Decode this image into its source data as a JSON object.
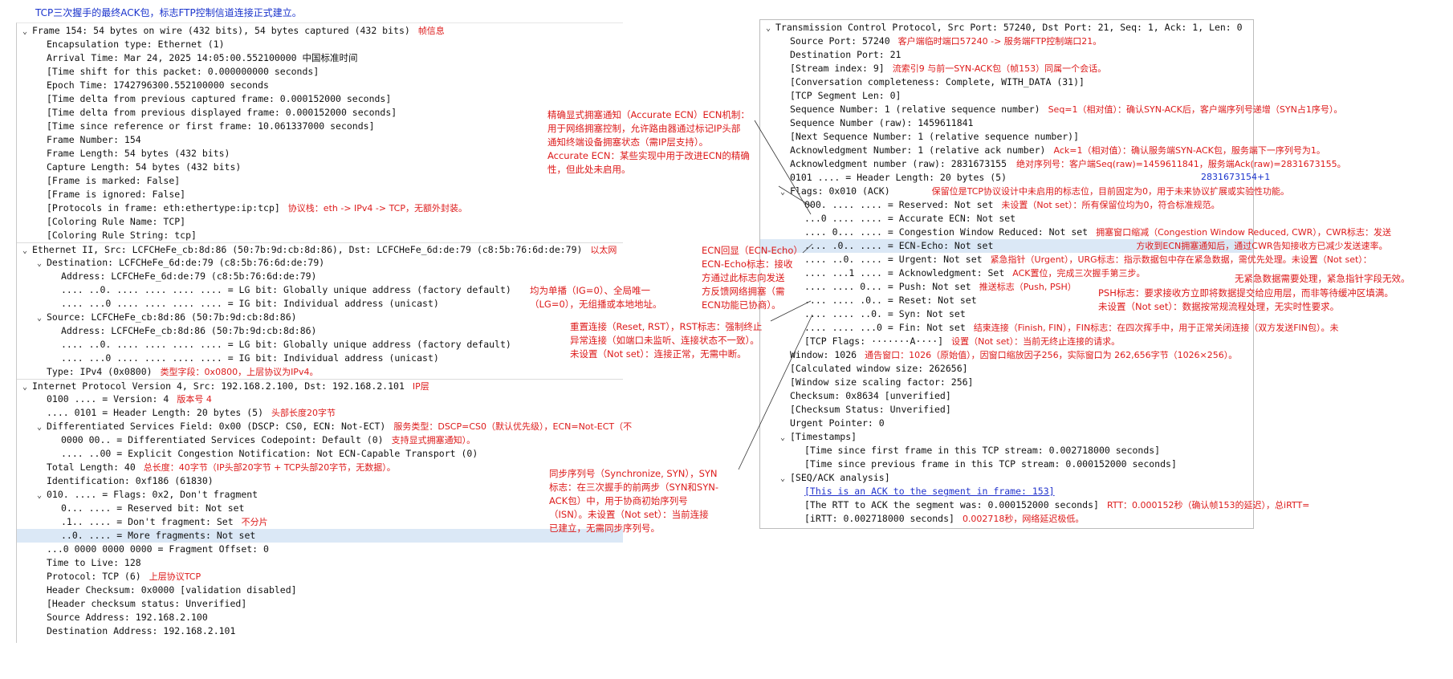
{
  "caption": "TCP三次握手的最终ACK包，标志FTP控制信道连接正式建立。",
  "left_tree": [
    {
      "text": "Frame 154: 54 bytes on wire (432 bits), 54 bytes captured (432 bits)",
      "toggle": "open",
      "note": "帧信息"
    },
    {
      "text": "Encapsulation type: Ethernet (1)"
    },
    {
      "text": "Arrival Time: Mar 24, 2025 14:05:00.552100000 中国标准时间"
    },
    {
      "text": "[Time shift for this packet: 0.000000000 seconds]"
    },
    {
      "text": "Epoch Time: 1742796300.552100000 seconds"
    },
    {
      "text": "[Time delta from previous captured frame: 0.000152000 seconds]"
    },
    {
      "text": "[Time delta from previous displayed frame: 0.000152000 seconds]"
    },
    {
      "text": "[Time since reference or first frame: 10.061337000 seconds]"
    },
    {
      "text": "Frame Number: 154"
    },
    {
      "text": "Frame Length: 54 bytes (432 bits)"
    },
    {
      "text": "Capture Length: 54 bytes (432 bits)"
    },
    {
      "text": "[Frame is marked: False]"
    },
    {
      "text": "[Frame is ignored: False]"
    },
    {
      "text": "[Protocols in frame: eth:ethertype:ip:tcp]",
      "note": "协议栈：eth -> IPv4 -> TCP，无额外封装。"
    },
    {
      "text": "[Coloring Rule Name: TCP]"
    },
    {
      "text": "[Coloring Rule String: tcp]"
    },
    {
      "text": "Ethernet II, Src: LCFCHeFe_cb:8d:86 (50:7b:9d:cb:8d:86), Dst: LCFCHeFe_6d:de:79 (c8:5b:76:6d:de:79)",
      "toggle": "open",
      "note": "以太网"
    },
    {
      "text": "Destination: LCFCHeFe_6d:de:79 (c8:5b:76:6d:de:79)",
      "toggle": "open"
    },
    {
      "text": "Address: LCFCHeFe_6d:de:79 (c8:5b:76:6d:de:79)"
    },
    {
      "text": ".... ..0. .... .... .... .... = LG bit: Globally unique address (factory default)"
    },
    {
      "text": ".... ...0 .... .... .... .... = IG bit: Individual address (unicast)"
    },
    {
      "text": "Source: LCFCHeFe_cb:8d:86 (50:7b:9d:cb:8d:86)",
      "toggle": "open"
    },
    {
      "text": "Address: LCFCHeFe_cb:8d:86 (50:7b:9d:cb:8d:86)"
    },
    {
      "text": ".... ..0. .... .... .... .... = LG bit: Globally unique address (factory default)"
    },
    {
      "text": ".... ...0 .... .... .... .... = IG bit: Individual address (unicast)"
    },
    {
      "text": "Type: IPv4 (0x0800)",
      "note": "类型字段：0x0800，上层协议为IPv4。"
    },
    {
      "text": "Internet Protocol Version 4, Src: 192.168.2.100, Dst: 192.168.2.101",
      "toggle": "open",
      "note": "IP层"
    },
    {
      "text": "0100 .... = Version: 4",
      "note": "版本号 4"
    },
    {
      "text": ".... 0101 = Header Length: 20 bytes (5)",
      "note": "头部长度20字节"
    },
    {
      "text": "Differentiated Services Field: 0x00 (DSCP: CS0, ECN: Not-ECT)",
      "toggle": "open",
      "note": "服务类型：DSCP=CS0（默认优先级），ECN=Not-ECT（不"
    },
    {
      "text": "0000 00.. = Differentiated Services Codepoint: Default (0)",
      "note": "支持显式拥塞通知）。"
    },
    {
      "text": ".... ..00 = Explicit Congestion Notification: Not ECN-Capable Transport (0)"
    },
    {
      "text": "Total Length: 40",
      "note": "总长度：40字节（IP头部20字节 + TCP头部20字节，无数据）。"
    },
    {
      "text": "Identification: 0xf186 (61830)"
    },
    {
      "text": "010. .... = Flags: 0x2, Don't fragment",
      "toggle": "open"
    },
    {
      "text": "0... .... = Reserved bit: Not set"
    },
    {
      "text": ".1.. .... = Don't fragment: Set",
      "note": "不分片"
    },
    {
      "text": "..0. .... = More fragments: Not set"
    },
    {
      "text": "...0 0000 0000 0000 = Fragment Offset: 0"
    },
    {
      "text": "Time to Live: 128"
    },
    {
      "text": "Protocol: TCP (6)",
      "note": "上层协议TCP"
    },
    {
      "text": "Header Checksum: 0x0000 [validation disabled]"
    },
    {
      "text": "[Header checksum status: Unverified]"
    },
    {
      "text": "Source Address: 192.168.2.100"
    },
    {
      "text": "Destination Address: 192.168.2.101"
    }
  ],
  "right_tree": [
    {
      "text": "Transmission Control Protocol, Src Port: 57240, Dst Port: 21, Seq: 1, Ack: 1, Len: 0",
      "toggle": "open"
    },
    {
      "text": "Source Port: 57240",
      "note": "客户端临时端口57240 -> 服务端FTP控制端口21。"
    },
    {
      "text": "Destination Port: 21"
    },
    {
      "text": "[Stream index: 9]",
      "note": "流索引9 与前一SYN-ACK包（帧153）同属一个会话。"
    },
    {
      "text": "[Conversation completeness: Complete, WITH_DATA (31)]"
    },
    {
      "text": "[TCP Segment Len: 0]"
    },
    {
      "text": "Sequence Number: 1    (relative sequence number)",
      "note": "Seq=1（相对值）：确认SYN-ACK后，客户端序列号递增（SYN占1序号）。"
    },
    {
      "text": "Sequence Number (raw): 1459611841"
    },
    {
      "text": "[Next Sequence Number: 1    (relative sequence number)]"
    },
    {
      "text": "Acknowledgment Number: 1    (relative ack number)",
      "note": "Ack=1（相对值）：确认服务端SYN-ACK包，服务端下一序列号为1。"
    },
    {
      "text": "Acknowledgment number (raw): 2831673155",
      "note": "绝对序列号：客户端Seq(raw)=1459611841，服务端Ack(raw)=2831673155。"
    },
    {
      "text": "0101 .... = Header Length: 20 bytes (5)"
    },
    {
      "text": "Flags: 0x010 (ACK)",
      "toggle": "open",
      "note": "保留位是TCP协议设计中未启用的标志位，目前固定为0，用于未来协议扩展或实验性功能。"
    },
    {
      "text": "000. .... .... = Reserved: Not set",
      "note": "未设置（Not set）：所有保留位均为0，符合标准规范。"
    },
    {
      "text": "...0 .... .... = Accurate ECN: Not set"
    },
    {
      "text": ".... 0... .... = Congestion Window Reduced: Not set",
      "note": "拥塞窗口缩减（Congestion Window Reduced, CWR），CWR标志：发送"
    },
    {
      "text": ".... .0.. .... = ECN-Echo: Not set",
      "note": "方收到ECN拥塞通知后，通过CWR告知接收方已减少发送速率。"
    },
    {
      "text": ".... ..0. .... = Urgent: Not set",
      "note": "紧急指针（Urgent），URG标志：指示数据包中存在紧急数据，需优先处理。未设置（Not set）："
    },
    {
      "text": ".... ...1 .... = Acknowledgment: Set",
      "note": "ACK置位，完成三次握手第三步。"
    },
    {
      "text": ".... .... 0... = Push: Not set",
      "note": "推送标志（Push, PSH）"
    },
    {
      "text": ".... .... .0.. = Reset: Not set"
    },
    {
      "text": ".... .... ..0. = Syn: Not set"
    },
    {
      "text": ".... .... ...0 = Fin: Not set",
      "note": "结束连接（Finish, FIN），FIN标志：在四次挥手中，用于正常关闭连接（双方发送FIN包）。未"
    },
    {
      "text": "[TCP Flags: ·······A····]",
      "note": "设置（Not set）：当前无终止连接的请求。"
    },
    {
      "text": "Window: 1026",
      "note": "通告窗口：1026（原始值），因窗口缩放因子256，实际窗口为 262,656字节（1026×256）。"
    },
    {
      "text": "[Calculated window size: 262656]"
    },
    {
      "text": "[Window size scaling factor: 256]"
    },
    {
      "text": "Checksum: 0x8634 [unverified]"
    },
    {
      "text": "[Checksum Status: Unverified]"
    },
    {
      "text": "Urgent Pointer: 0"
    },
    {
      "text": "[Timestamps]",
      "toggle": "open"
    },
    {
      "text": "[Time since first frame in this TCP stream: 0.002718000 seconds]"
    },
    {
      "text": "[Time since previous frame in this TCP stream: 0.000152000 seconds]"
    },
    {
      "text": "[SEQ/ACK analysis]",
      "toggle": "open"
    },
    {
      "text": "[This is an ACK to the segment in frame: 153]",
      "link": true
    },
    {
      "text": "[The RTT to ACK the segment was: 0.000152000 seconds]",
      "note": "RTT：0.000152秒（确认帧153的延迟），总iRTT="
    },
    {
      "text": "[iRTT: 0.002718000 seconds]",
      "note": "0.002718秒，网络延迟极低。"
    }
  ],
  "floating_notes": {
    "accurate_ecn": [
      "精确显式拥塞通知（Accurate ECN）ECN机制：",
      "用于网络拥塞控制，允许路由器通过标记IP头部",
      "通知终端设备拥塞状态（需IP层支持）。",
      "Accurate ECN：某些实现中用于改进ECN的精确",
      "性，但此处未启用。"
    ],
    "ecn_echo": [
      "ECN回显（ECN-Echo）",
      "ECN-Echo标志：接收",
      "方通过此标志向发送",
      "方反馈网络拥塞（需",
      "ECN功能已协商）。"
    ],
    "unicast": [
      "均为单播（IG=0）、全局唯一",
      "（LG=0），无组播或本地地址。"
    ],
    "reset": [
      "重置连接（Reset, RST），RST标志：强制终止",
      "异常连接（如端口未监听、连接状态不一致）。",
      "未设置（Not set）：连接正常，无需中断。"
    ],
    "syn": [
      "同步序列号（Synchronize, SYN），SYN",
      "标志：在三次握手的前两步（SYN和SYN-",
      "ACK包）中，用于协商初始序列号",
      "（ISN）。未设置（Not set）：当前连接",
      "已建立，无需同步序列号。"
    ],
    "urgent_cont": "无紧急数据需要处理，紧急指针字段无效。",
    "psh": [
      "PSH标志：要求接收方立即将数据提交给应用层，而非等待缓冲区填满。",
      "未设置（Not set）：数据按常规流程处理，无实时性要求。"
    ],
    "ack_plus": "2831673154+1"
  }
}
